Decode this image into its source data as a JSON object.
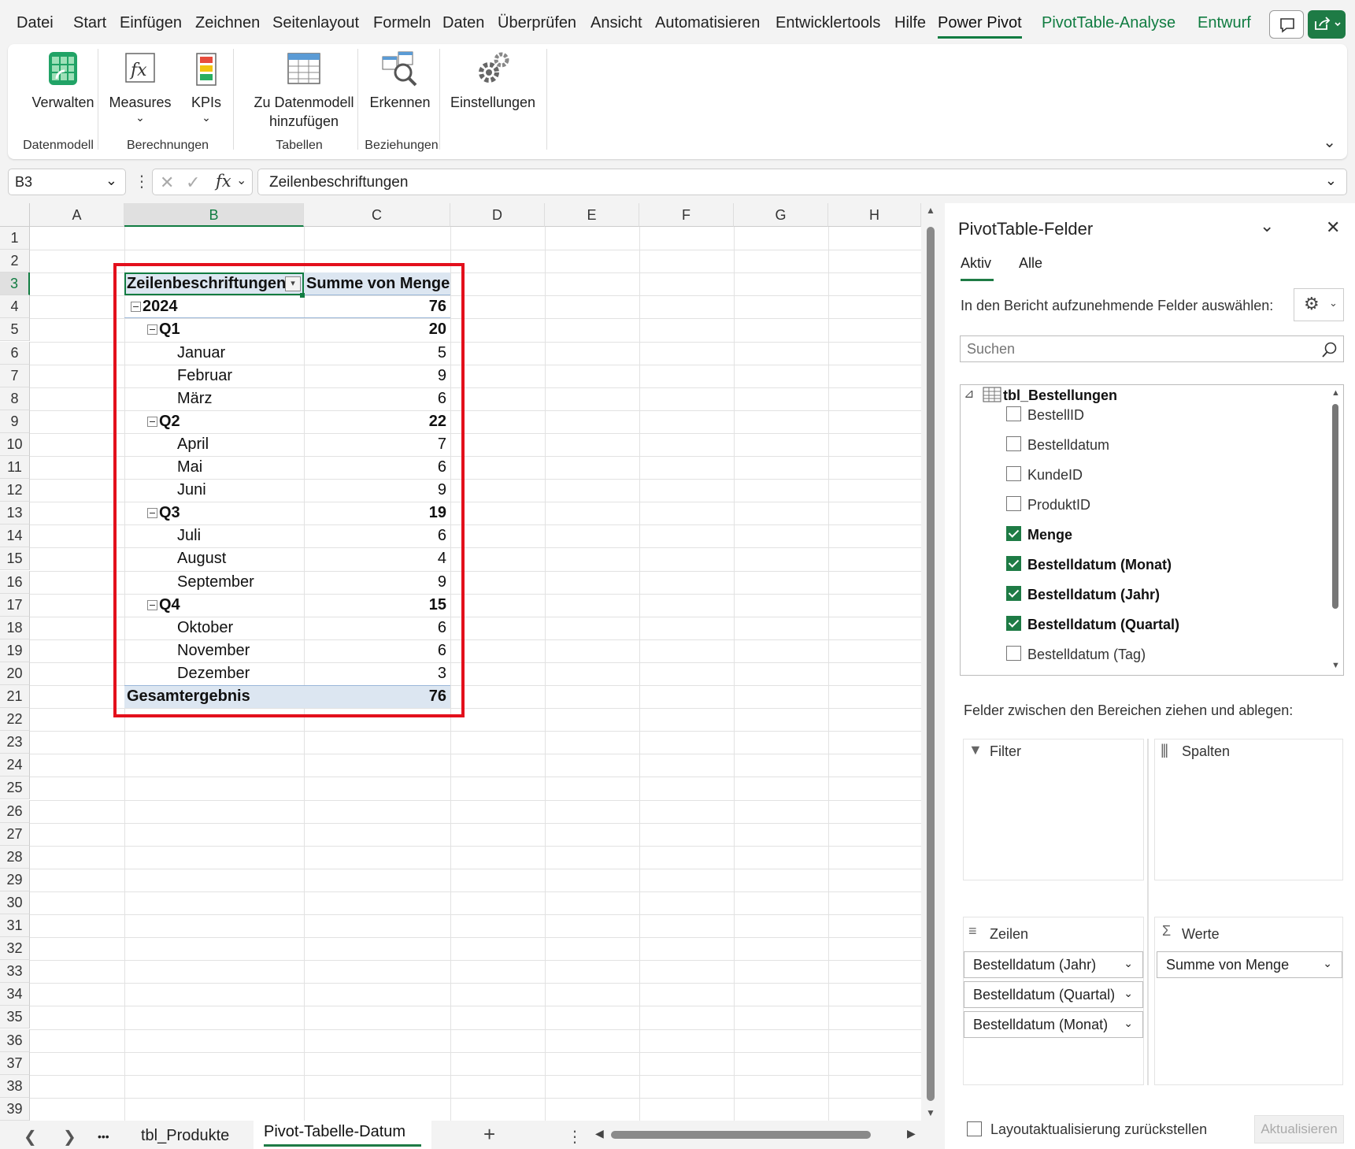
{
  "menu": {
    "tabs": [
      "Datei",
      "Start",
      "Einfügen",
      "Zeichnen",
      "Seitenlayout",
      "Formeln",
      "Daten",
      "Überprüfen",
      "Ansicht",
      "Automatisieren",
      "Entwicklertools",
      "Hilfe",
      "Power Pivot",
      "PivotTable-Analyse",
      "Entwurf"
    ]
  },
  "ribbon": {
    "verwalten": "Verwalten",
    "measures": "Measures",
    "kpis": "KPIs",
    "zu_datenmodell_1": "Zu Datenmodell",
    "zu_datenmodell_2": "hinzufügen",
    "erkennen": "Erkennen",
    "einstellungen": "Einstellungen",
    "groups": {
      "datenmodell": "Datenmodell",
      "berechnungen": "Berechnungen",
      "tabellen": "Tabellen",
      "beziehungen": "Beziehungen"
    }
  },
  "formula_bar": {
    "name_box": "B3",
    "fx": "fx",
    "formula": "Zeilenbeschriftungen"
  },
  "columns": [
    "A",
    "B",
    "C",
    "D",
    "E",
    "F",
    "G",
    "H"
  ],
  "rows": [
    "1",
    "2",
    "3",
    "4",
    "5",
    "6",
    "7",
    "8",
    "9",
    "10",
    "11",
    "12",
    "13",
    "14",
    "15",
    "16",
    "17",
    "18",
    "19",
    "20",
    "21",
    "22",
    "23",
    "24",
    "25",
    "26",
    "27",
    "28",
    "29",
    "30",
    "31",
    "32",
    "33",
    "34",
    "35",
    "36",
    "37",
    "38",
    "39"
  ],
  "pivot": {
    "header_label": "Zeilenbeschriftungen",
    "header_value": "Summe von Menge",
    "rows": [
      {
        "label": "2024",
        "value": "76",
        "level": 0,
        "bold": true,
        "toggle": "⊟"
      },
      {
        "label": "Q1",
        "value": "20",
        "level": 1,
        "bold": true,
        "toggle": "⊟"
      },
      {
        "label": "Januar",
        "value": "5",
        "level": 2
      },
      {
        "label": "Februar",
        "value": "9",
        "level": 2
      },
      {
        "label": "März",
        "value": "6",
        "level": 2
      },
      {
        "label": "Q2",
        "value": "22",
        "level": 1,
        "bold": true,
        "toggle": "⊟"
      },
      {
        "label": "April",
        "value": "7",
        "level": 2
      },
      {
        "label": "Mai",
        "value": "6",
        "level": 2
      },
      {
        "label": "Juni",
        "value": "9",
        "level": 2
      },
      {
        "label": "Q3",
        "value": "19",
        "level": 1,
        "bold": true,
        "toggle": "⊟"
      },
      {
        "label": "Juli",
        "value": "6",
        "level": 2
      },
      {
        "label": "August",
        "value": "4",
        "level": 2
      },
      {
        "label": "September",
        "value": "9",
        "level": 2
      },
      {
        "label": "Q4",
        "value": "15",
        "level": 1,
        "bold": true,
        "toggle": "⊟"
      },
      {
        "label": "Oktober",
        "value": "6",
        "level": 2
      },
      {
        "label": "November",
        "value": "6",
        "level": 2
      },
      {
        "label": "Dezember",
        "value": "3",
        "level": 2
      }
    ],
    "total_label": "Gesamtergebnis",
    "total_value": "76"
  },
  "pane": {
    "title": "PivotTable-Felder",
    "tab_active": "Aktiv",
    "tab_all": "Alle",
    "choose_label": "In den Bericht aufzunehmende Felder auswählen:",
    "search_placeholder": "Suchen",
    "table_name": "tbl_Bestellungen",
    "fields": [
      {
        "name": "BestellID",
        "checked": false
      },
      {
        "name": "Bestelldatum",
        "checked": false
      },
      {
        "name": "KundeID",
        "checked": false
      },
      {
        "name": "ProduktID",
        "checked": false
      },
      {
        "name": "Menge",
        "checked": true
      },
      {
        "name": "Bestelldatum (Monat)",
        "checked": true
      },
      {
        "name": "Bestelldatum (Jahr)",
        "checked": true
      },
      {
        "name": "Bestelldatum (Quartal)",
        "checked": true
      },
      {
        "name": "Bestelldatum (Tag)",
        "checked": false
      }
    ],
    "drag_label": "Felder zwischen den Bereichen ziehen und ablegen:",
    "filter_label": "Filter",
    "columns_label": "Spalten",
    "rows_label": "Zeilen",
    "values_label": "Werte",
    "row_fields": [
      "Bestelldatum (Jahr)",
      "Bestelldatum (Quartal)",
      "Bestelldatum (Monat)"
    ],
    "value_fields": [
      "Summe von Menge"
    ],
    "defer_label": "Layoutaktualisierung zurückstellen",
    "update_button": "Aktualisieren"
  },
  "sheet_tabs": {
    "ellipsis": "•••",
    "tab1": "tbl_Produkte",
    "tab2": "Pivot-Tabelle-Datum",
    "add": "+"
  }
}
